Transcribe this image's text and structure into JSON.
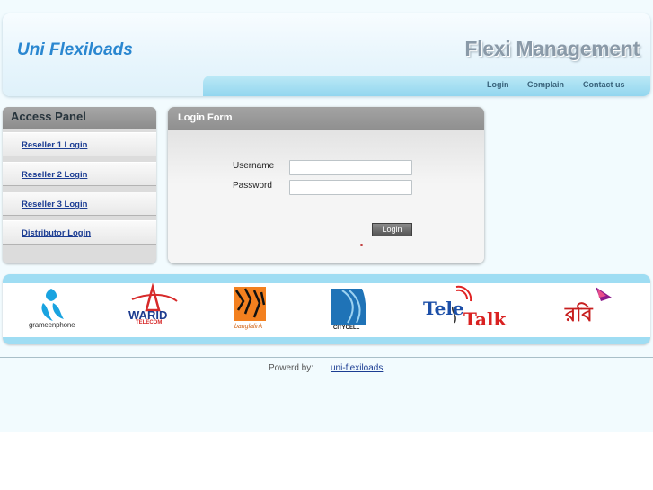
{
  "header": {
    "site_title": "Uni Flexiloads",
    "tagline": "Flexi Management",
    "nav": [
      {
        "label": "Login"
      },
      {
        "label": "Complain"
      },
      {
        "label": "Contact us"
      }
    ]
  },
  "access_panel": {
    "title": "Access Panel",
    "items": [
      {
        "label": "Reseller 1 Login"
      },
      {
        "label": "Reseller 2 Login"
      },
      {
        "label": "Reseller 3 Login"
      },
      {
        "label": "Distributor Login"
      }
    ]
  },
  "login_form": {
    "title": "Login Form",
    "username_label": "Username",
    "password_label": "Password",
    "username_value": "",
    "password_value": "",
    "login_button": "Login"
  },
  "operators": [
    {
      "name": "grameenphone",
      "icon": "grameenphone-logo"
    },
    {
      "name": "WARID",
      "sub": "TELECOM",
      "icon": "warid-logo"
    },
    {
      "name": "banglalink",
      "icon": "banglalink-logo"
    },
    {
      "name": "CITYCELL",
      "icon": "citycell-logo"
    },
    {
      "name": "Tele",
      "name2": "Talk",
      "icon": "teletalk-logo"
    },
    {
      "name": "রবি",
      "icon": "robi-logo"
    }
  ],
  "footer": {
    "powered_label": "Powerd by:",
    "powered_link": "uni-flexiloads"
  },
  "colors": {
    "title_blue": "#2a87d0",
    "nav_bar": "#a8e0f3",
    "link_blue": "#1c3d93",
    "panel_gray": "#9a9a9a"
  }
}
